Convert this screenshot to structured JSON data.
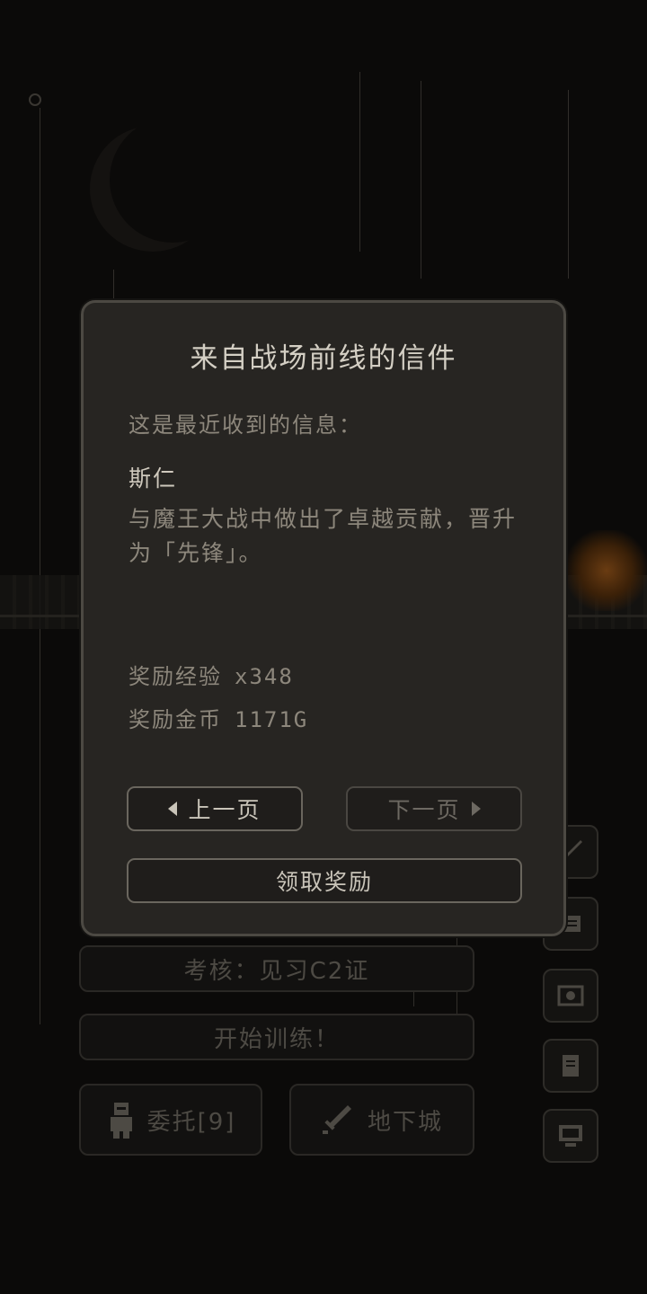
{
  "modal": {
    "title": "来自战场前线的信件",
    "intro": "这是最近收到的信息：",
    "sender": "斯仁",
    "message": "与魔王大战中做出了卓越贡献，晋升为「先锋」。",
    "rewards": {
      "exp_label": "奖励经验",
      "exp_value": "x348",
      "gold_label": "奖励金币",
      "gold_value": "1171G"
    },
    "prev_label": "上一页",
    "next_label": "下一页",
    "claim_label": "领取奖励"
  },
  "background": {
    "exam_label": "考核：见习C2证",
    "train_label": "开始训练！",
    "commission_label": "委托[9]",
    "dungeon_label": "地下城"
  },
  "icons": {
    "prev": "triangle-left-icon",
    "next": "triangle-right-icon",
    "commission": "knight-icon",
    "dungeon": "sword-icon",
    "side": [
      "sword-icon",
      "scroll-icon",
      "map-icon",
      "document-icon",
      "computer-icon"
    ]
  },
  "colors": {
    "background": "#0b0a09",
    "panel": "#272522",
    "panel_border": "#4c4943",
    "title_text": "#d4cfc4",
    "body_text": "#8d877c"
  }
}
